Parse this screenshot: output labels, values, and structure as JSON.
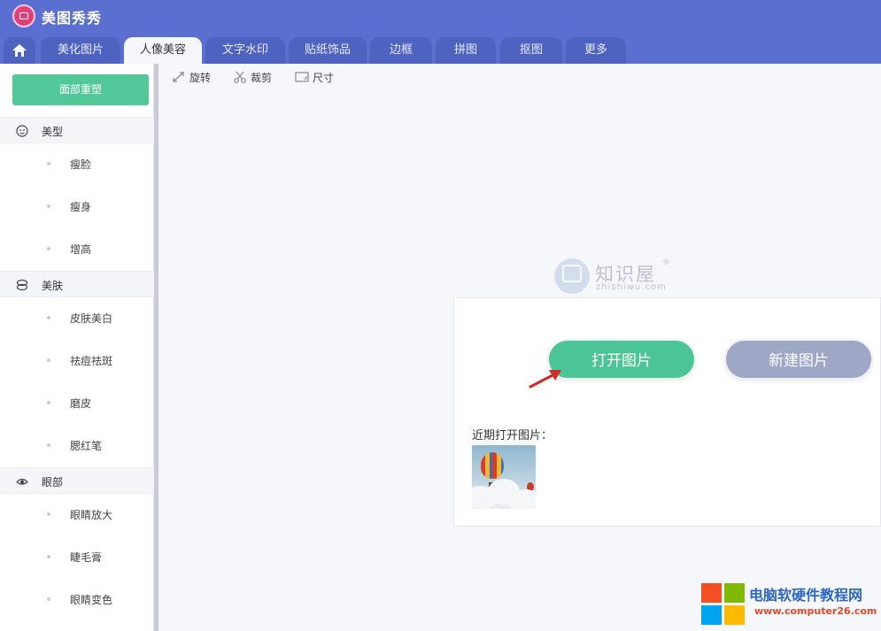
{
  "app": {
    "title": "美图秀秀"
  },
  "tabs": {
    "home_icon": "home-icon",
    "items": [
      {
        "label": "美化图片",
        "active": false
      },
      {
        "label": "人像美容",
        "active": true
      },
      {
        "label": "文字水印",
        "active": false
      },
      {
        "label": "贴纸饰品",
        "active": false
      },
      {
        "label": "边框",
        "active": false
      },
      {
        "label": "拼图",
        "active": false
      },
      {
        "label": "抠图",
        "active": false
      },
      {
        "label": "更多",
        "active": false
      }
    ]
  },
  "sidebar": {
    "primary_button": "面部重塑",
    "sections": [
      {
        "label": "美型",
        "icon": "face-icon",
        "items": [
          "瘦脸",
          "瘦身",
          "增高"
        ]
      },
      {
        "label": "美肤",
        "icon": "skin-icon",
        "items": [
          "皮肤美白",
          "祛痘祛斑",
          "磨皮",
          "腮红笔"
        ]
      },
      {
        "label": "眼部",
        "icon": "eye-icon",
        "items": [
          "眼睛放大",
          "睫毛膏",
          "眼睛变色"
        ]
      }
    ]
  },
  "toolbar": {
    "rotate": "旋转",
    "crop": "裁剪",
    "size": "尺寸"
  },
  "watermark": {
    "title": "知识屋",
    "reg": "®",
    "sub": "zhishiwu.com"
  },
  "panel": {
    "open_button": "打开图片",
    "new_button": "新建图片",
    "recent_label": "近期打开图片："
  },
  "brand": {
    "title": "电脑软硬件教程网",
    "url": "www.computer26.com"
  },
  "colors": {
    "header": "#5a6fcf",
    "accent_green": "#52c79a",
    "secondary_button": "#9ea7c6"
  }
}
